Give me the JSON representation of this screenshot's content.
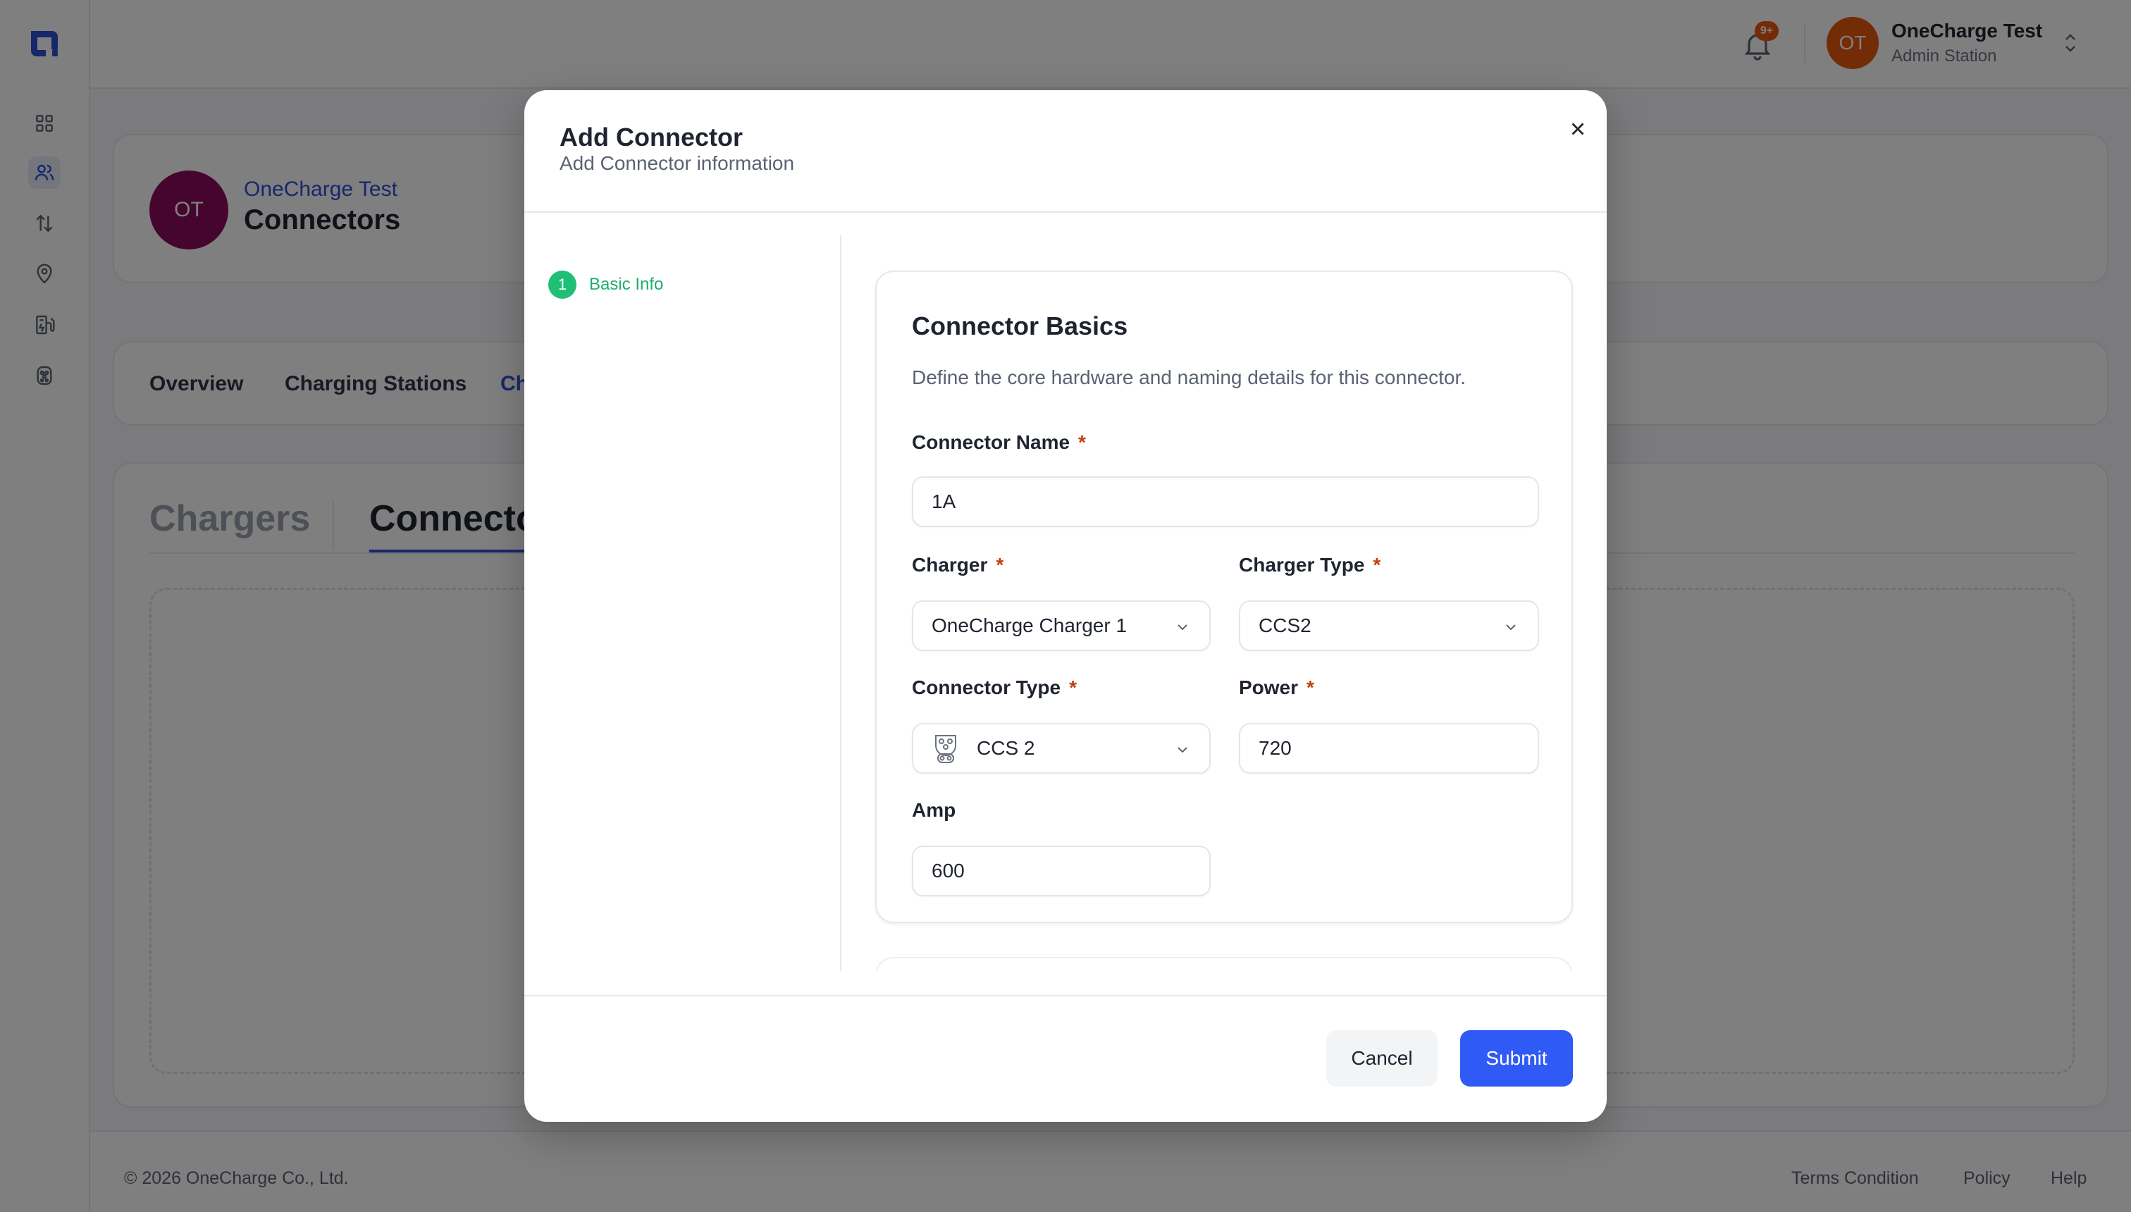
{
  "user": {
    "initials": "OT",
    "name": "OneCharge Test",
    "role": "Admin Station"
  },
  "notifications": {
    "badge": "9+"
  },
  "sidebar": {
    "items": [
      "dashboard-icon",
      "users-icon",
      "transfer-icon",
      "location-icon",
      "charging-station-icon",
      "connector-icon"
    ],
    "active": "users-icon"
  },
  "header": {
    "avatar": "OT",
    "subtitle": "OneCharge Test",
    "title": "Connectors"
  },
  "top_tabs": [
    "Overview",
    "Charging Stations",
    "Ch"
  ],
  "sub_tabs": [
    "Chargers",
    "Connecto"
  ],
  "footer": {
    "copyright": "© 2026 OneCharge Co., Ltd.",
    "links": [
      "Terms Condition",
      "Policy",
      "Help"
    ]
  },
  "modal": {
    "title": "Add Connector",
    "subtitle": "Add Connector information",
    "step": {
      "number": "1",
      "label": "Basic Info"
    },
    "section": {
      "title": "Connector Basics",
      "description": "Define the core hardware and naming details for this connector."
    },
    "fields": {
      "connector_name": {
        "label": "Connector Name",
        "required": "*",
        "value": "1A"
      },
      "charger": {
        "label": "Charger",
        "required": "*",
        "value": "OneCharge Charger 1"
      },
      "charger_type": {
        "label": "Charger Type",
        "required": "*",
        "value": "CCS2"
      },
      "connector_type": {
        "label": "Connector Type",
        "required": "*",
        "value": "CCS 2"
      },
      "power": {
        "label": "Power",
        "required": "*",
        "value": "720"
      },
      "amp": {
        "label": "Amp",
        "value": "600"
      }
    },
    "buttons": {
      "cancel": "Cancel",
      "submit": "Submit"
    }
  },
  "colors": {
    "primary": "#2f5af5",
    "success": "#1fbf75",
    "required": "#c2410c",
    "user_avatar": "#e8590c",
    "header_avatar": "#8a0a5c"
  }
}
